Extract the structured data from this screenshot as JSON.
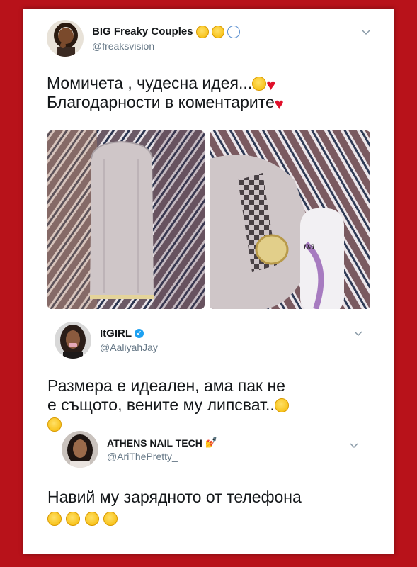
{
  "tweets": [
    {
      "display_name": "BIG Freaky Couples",
      "handle": "@freaksvision",
      "text_line1": "Момичета , чудесна идея...",
      "text_line2": "Благодарности в коментарите",
      "avatar_icon": "woman-portrait-icon",
      "chevron_icon": "chevron-down-icon"
    },
    {
      "display_name": "ItGIRL",
      "handle": "@AaliyahJay",
      "text_line1": "Размера е идеален, ама пак не",
      "text_line2": "е същото, вените му липсват..",
      "verified_icon": "verified-badge-icon",
      "chevron_icon": "chevron-down-icon"
    },
    {
      "display_name": "ATHENS NAIL TECH",
      "handle": "@AriThePretty_",
      "text_line1": "Навий му зарядното от телефона",
      "chevron_icon": "chevron-down-icon"
    }
  ],
  "colors": {
    "frame": "#b8121a",
    "card": "#ffffff",
    "text": "#14171a",
    "handle": "#657786",
    "verified": "#1da1f2"
  },
  "photos": [
    {
      "name": "sock-photo-left",
      "icon": "photo-image"
    },
    {
      "name": "sock-photo-right",
      "icon": "photo-image"
    }
  ]
}
